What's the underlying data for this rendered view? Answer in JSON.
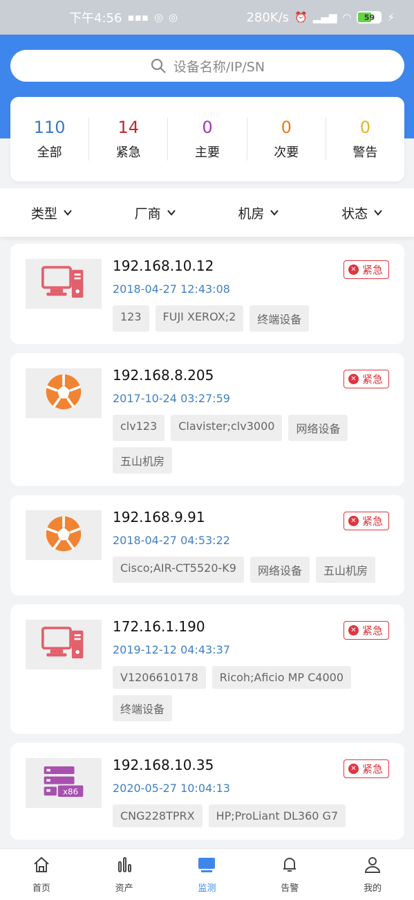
{
  "status_bar": {
    "time": "下午4:56",
    "speed": "280K/s",
    "battery": "59"
  },
  "search": {
    "placeholder": "设备名称/IP/SN"
  },
  "stats": [
    {
      "num": "110",
      "label": "全部",
      "color": "#3a78c9"
    },
    {
      "num": "14",
      "label": "紧急",
      "color": "#c0282f"
    },
    {
      "num": "0",
      "label": "主要",
      "color": "#a433b8"
    },
    {
      "num": "0",
      "label": "次要",
      "color": "#ea7a16"
    },
    {
      "num": "0",
      "label": "警告",
      "color": "#e6b32a"
    }
  ],
  "filters": [
    "类型",
    "厂商",
    "机房",
    "状态"
  ],
  "devices": [
    {
      "icon": "desktop-icon",
      "ip": "192.168.10.12",
      "time": "2018-04-27 12:43:08",
      "badge": "紧急",
      "tags": [
        "123",
        "FUJI XEROX;2",
        "终端设备"
      ]
    },
    {
      "icon": "network-ball-icon",
      "ip": "192.168.8.205",
      "time": "2017-10-24 03:27:59",
      "badge": "紧急",
      "tags": [
        "clv123",
        "Clavister;clv3000",
        "网络设备",
        "五山机房"
      ]
    },
    {
      "icon": "network-ball-icon",
      "ip": "192.168.9.91",
      "time": "2018-04-27 04:53:22",
      "badge": "紧急",
      "tags": [
        "Cisco;AIR-CT5520-K9",
        "网络设备",
        "五山机房"
      ]
    },
    {
      "icon": "desktop-icon",
      "ip": "172.16.1.190",
      "time": "2019-12-12 04:43:37",
      "badge": "紧急",
      "tags": [
        "V1206610178",
        "Ricoh;Aficio MP C4000",
        "终端设备"
      ]
    },
    {
      "icon": "server-x86-icon",
      "ip": "192.168.10.35",
      "time": "2020-05-27 10:04:13",
      "badge": "紧急",
      "tags": [
        "CNG228TPRX",
        "HP;ProLiant DL360 G7"
      ]
    }
  ],
  "nav": [
    {
      "icon": "home-icon",
      "label": "首页"
    },
    {
      "icon": "bar-chart-icon",
      "label": "资产"
    },
    {
      "icon": "monitor-icon",
      "label": "监测",
      "active": true
    },
    {
      "icon": "bell-icon",
      "label": "告警"
    },
    {
      "icon": "user-icon",
      "label": "我的"
    }
  ],
  "colors": {
    "accent": "#3f86ec",
    "urgent": "#e0353f"
  }
}
